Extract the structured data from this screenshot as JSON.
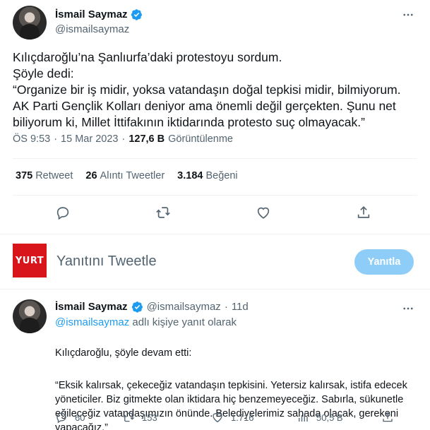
{
  "main_tweet": {
    "author_name": "İsmail Saymaz",
    "author_handle": "@ismailsaymaz",
    "text": "Kılıçdaroğlu’na Şanlıurfa’daki protestoyu sordum.\nŞöyle dedi:\n“Organize bir iş midir, yoksa vatandaşın doğal tepkisi midir, bilmiyorum. AK Parti Gençlik Kolları deniyor ama önemli değil gerçekten. Şunu net biliyorum ki, Millet İttifakının iktidarında protesto suç olmayacak.”",
    "time": "ÖS 9:53",
    "date": "15 Mar 2023",
    "views_count": "127,6 B",
    "views_label": "Görüntülenme",
    "stats": {
      "retweets": {
        "num": "375",
        "label": "Retweet"
      },
      "quotes": {
        "num": "26",
        "label": "Alıntı Tweetler"
      },
      "likes": {
        "num": "3.184",
        "label": "Beğeni"
      }
    }
  },
  "reply_box": {
    "logo_text": "YURT",
    "placeholder": "Yanıtını Tweetle",
    "button_label": "Yanıtla"
  },
  "reply_tweet": {
    "author_name": "İsmail Saymaz",
    "author_handle": "@ismailsaymaz",
    "age": "11d",
    "replying_mention": "@ismailsaymaz",
    "replying_suffix": "adlı kişiye yanıt olarak",
    "text_line1": "Kılıçdaroğlu, şöyle devam etti:",
    "text_quote": "“Eksik kalırsak, çekeceğiz vatandaşın tepkisini. Yetersiz kalırsak, istifa edecek yöneticiler. Biz gitmekte olan iktidara hiç benzemeyeceğiz. Sabırla, sükunetle eğileceğiz vatandaşımızın önünde. Belediyelerimiz sahada olacak, gerekeni yapacağız.”",
    "replies": "60",
    "retweets": "153",
    "likes": "1.716",
    "views": "50,5 B"
  },
  "colors": {
    "accent": "#1d9bf0",
    "secondary_text": "#536471",
    "reply_button_disabled": "#8ecdf8",
    "yurt_red": "#d7151b"
  },
  "icons": [
    "verified-badge-icon",
    "more-icon",
    "reply-icon",
    "retweet-icon",
    "like-icon",
    "share-icon",
    "views-icon"
  ]
}
